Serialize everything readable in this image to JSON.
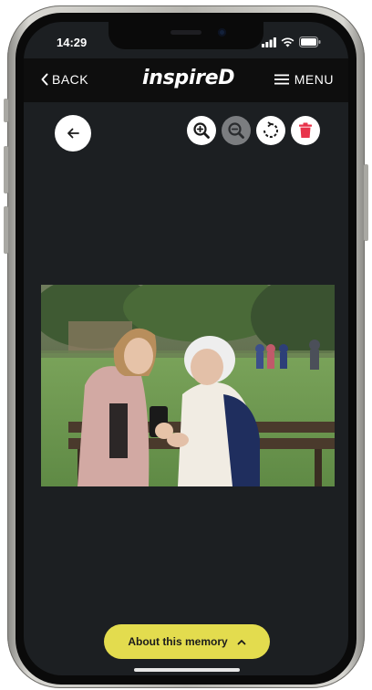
{
  "status": {
    "time": "14:29"
  },
  "nav": {
    "back_label": "BACK",
    "logo": "inspireD",
    "menu_label": "MENU"
  },
  "toolbar": {
    "zoom_in_icon": "zoom-in-icon",
    "zoom_out_icon": "zoom-out-icon",
    "rotate_icon": "rotate-icon",
    "delete_icon": "trash-icon"
  },
  "colors": {
    "accent_yellow": "#e3dc4e",
    "delete_red": "#e8334a",
    "topbar": "#0e0e0e",
    "background": "#1c1f22"
  },
  "footer": {
    "about_label": "About this memory"
  }
}
